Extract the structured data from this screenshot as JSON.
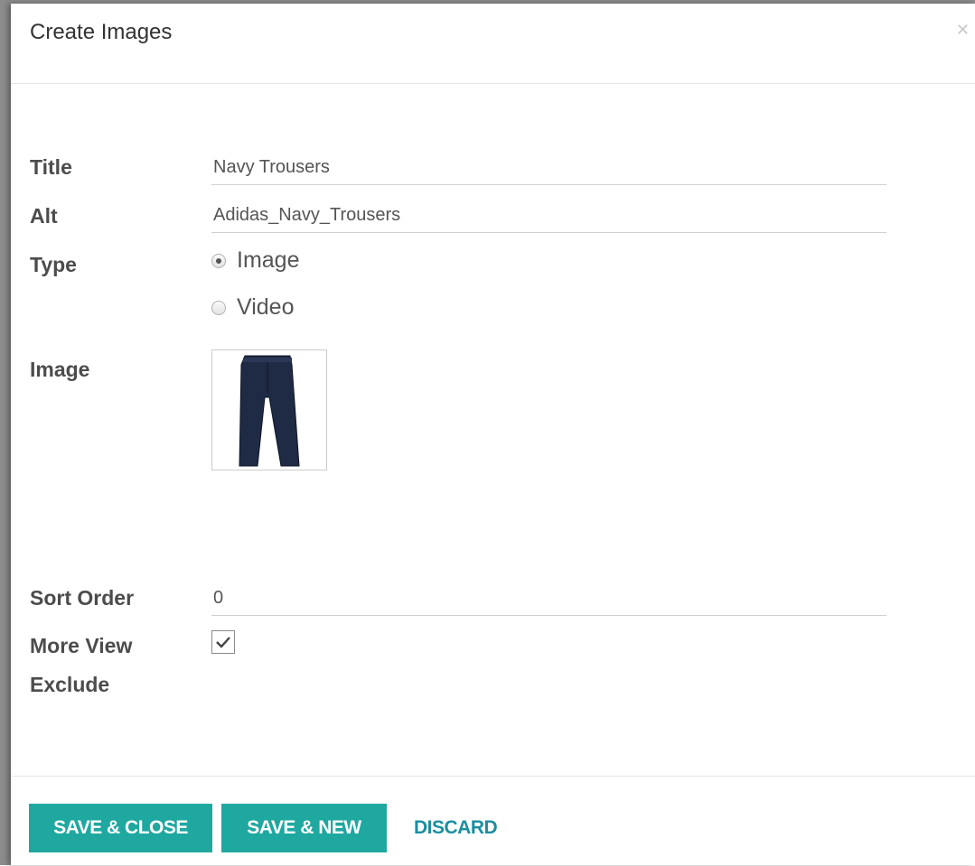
{
  "dialog": {
    "title": "Create Images",
    "close_icon": "close-icon"
  },
  "form": {
    "title_label": "Title",
    "title_value": "Navy Trousers",
    "alt_label": "Alt",
    "alt_value": "Adidas_Navy_Trousers",
    "type_label": "Type",
    "type_options": [
      {
        "label": "Image",
        "checked": true
      },
      {
        "label": "Video",
        "checked": false
      }
    ],
    "image_label": "Image",
    "image_icon": "trousers-image",
    "sort_order_label": "Sort Order",
    "sort_order_value": "0",
    "more_view_exclude_label_line1": "More View",
    "more_view_exclude_label_line2": "Exclude",
    "more_view_exclude_checked": true
  },
  "footer": {
    "save_close_label": "SAVE & CLOSE",
    "save_new_label": "SAVE & NEW",
    "discard_label": "DISCARD"
  },
  "colors": {
    "primary_button": "#1ea8a0",
    "link": "#1a8fa0",
    "label": "#4c4c4c"
  }
}
